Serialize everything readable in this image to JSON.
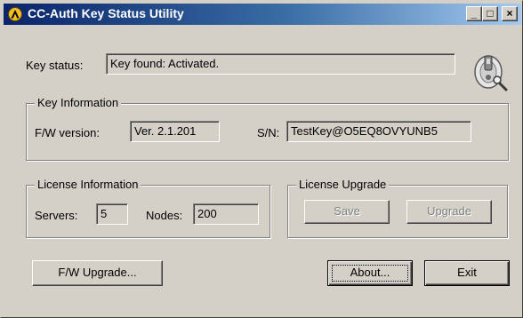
{
  "window": {
    "title": "CC-Auth Key Status Utility",
    "controls": {
      "minimize": "_",
      "maximize": "□",
      "close": "×"
    }
  },
  "key_status": {
    "label": "Key status:",
    "value": "Key found: Activated.",
    "icon": "usb-key-icon"
  },
  "key_info": {
    "group_title": "Key Information",
    "fw_label": "F/W version:",
    "fw_value": "Ver. 2.1.201",
    "sn_label": "S/N:",
    "sn_value": "TestKey@O5EQ8OVYUNB5"
  },
  "license_info": {
    "group_title": "License Information",
    "servers_label": "Servers:",
    "servers_value": "5",
    "nodes_label": "Nodes:",
    "nodes_value": "200"
  },
  "license_upgrade": {
    "group_title": "License Upgrade",
    "save_label": "Save",
    "upgrade_label": "Upgrade"
  },
  "buttons": {
    "fw_upgrade": "F/W Upgrade...",
    "about": "About...",
    "exit": "Exit"
  },
  "colors": {
    "face": "#d4d0c8",
    "titlebar_start": "#0a246a",
    "titlebar_end": "#a6caf0",
    "disabled_text": "#808080"
  }
}
